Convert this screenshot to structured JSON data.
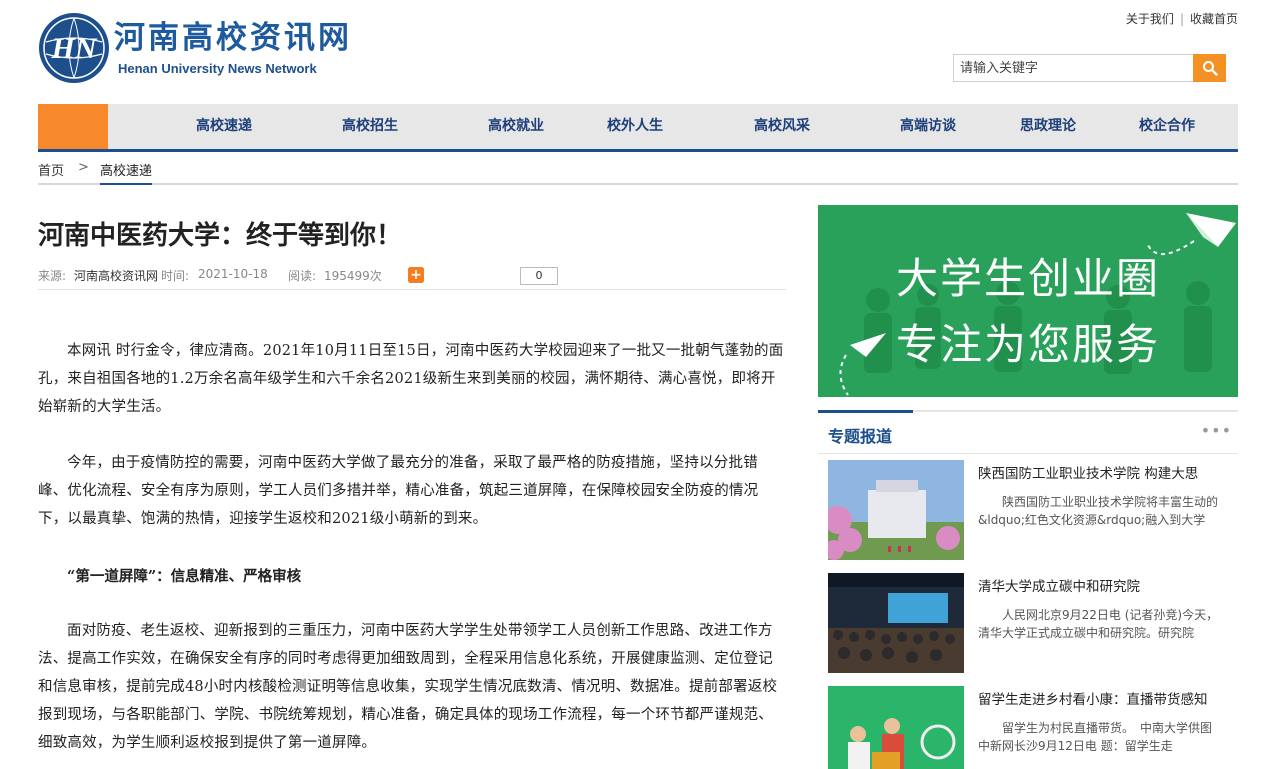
{
  "header": {
    "logo_cn": "河南高校资讯网",
    "logo_en": "Henan University News Network",
    "top_links": [
      "关于我们",
      "收藏首页"
    ],
    "search_placeholder": "请输入关键字",
    "search_icon": "search-icon"
  },
  "nav": {
    "items": [
      "高校速递",
      "高校招生",
      "高校就业",
      "校外人生",
      "高校风采",
      "高端访谈",
      "思政理论",
      "校企合作"
    ]
  },
  "breadcrumb": {
    "home": "首页",
    "separator": ">",
    "current": "高校速递"
  },
  "article": {
    "title": "河南中医药大学：终于等到你！",
    "source_label": "来源:",
    "source": "河南高校资讯网",
    "time_label": "时间:",
    "time": "2021-10-18",
    "reads_label": "阅读:",
    "reads": "195499次",
    "share_count": "0",
    "share_icons": [
      "qzone-icon",
      "weibo-icon",
      "tencent-weibo-icon",
      "wechat-icon",
      "more-share-icon"
    ],
    "paragraphs": [
      "本网讯 时行金令，律应清商。2021年10月11日至15日，河南中医药大学校园迎来了一批又一批朝气蓬勃的面孔，来自祖国各地的1.2万余名高年级学生和六千余名2021级新生来到美丽的校园，满怀期待、满心喜悦，即将开始崭新的大学生活。",
      "今年，由于疫情防控的需要，河南中医药大学做了最充分的准备，采取了最严格的防疫措施，坚持以分批错峰、优化流程、安全有序为原则，学工人员们多措并举，精心准备，筑起三道屏障，在保障校园安全防疫的情况下，以最真挚、饱满的热情，迎接学生返校和2021级小萌新的到来。",
      "面对防疫、老生返校、迎新报到的三重压力，河南中医药大学学生处带领学工人员创新工作思路、改进工作方法、提高工作实效，在确保安全有序的同时考虑得更加细致周到，全程采用信息化系统，开展健康监测、定位登记和信息审核，提前完成48小时内核酸检测证明等信息收集，实现学生情况底数清、情况明、数据准。提前部署返校报到现场，与各职能部门、学院、书院统筹规划，精心准备，确定具体的现场工作流程，每一个环节都严谨规范、细致高效，为学生顺利返校报到提供了第一道屏障。"
    ],
    "subheading": "“第一道屏障”：信息精准、严格审核"
  },
  "sidebar": {
    "banner_line1": "大学生创业圈",
    "banner_line2": "专注为您服务",
    "topic_label": "专题报道",
    "topic_more": "•••",
    "news": [
      {
        "title": "陕西国防工业职业技术学院 构建大思",
        "summary": "陕西国防工业职业技术学院将丰富生动的&ldquo;红色文化资源&rdquo;融入到大学"
      },
      {
        "title": "清华大学成立碳中和研究院",
        "summary": "人民网北京9月22日电 (记者孙竞)今天，清华大学正式成立碳中和研究院。研究院"
      },
      {
        "title": "留学生走进乡村看小康：直播带货感知",
        "summary": "留学生为村民直播带货。　中南大学供图　　中新网长沙9月12日电 题：留学生走"
      }
    ]
  },
  "colors": {
    "brand_blue": "#1d4f8c",
    "nav_orange": "#f7882c",
    "search_orange": "#f39125",
    "banner_green": "#2aa15a"
  }
}
